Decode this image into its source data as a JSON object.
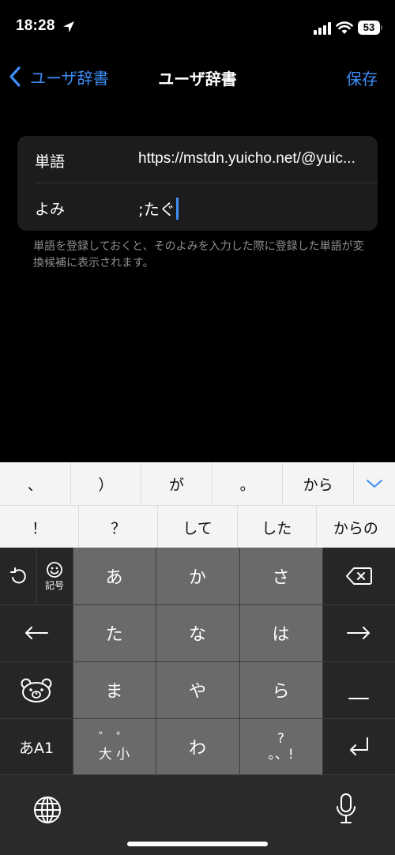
{
  "status_bar": {
    "time": "18:28",
    "battery": "53",
    "icons": [
      "location-arrow-icon",
      "cellular-signal-icon",
      "wifi-icon",
      "battery-icon"
    ]
  },
  "nav": {
    "back_label": "ユーザ辞書",
    "title": "ユーザ辞書",
    "save_label": "保存"
  },
  "form": {
    "word_label": "単語",
    "word_value": "https://mstdn.yuicho.net/@yuic...",
    "yomi_label": "よみ",
    "yomi_value": ";たぐ"
  },
  "help_text": "単語を登録しておくと、そのよみを入力した際に登録した単語が変換候補に表示されます。",
  "keyboard": {
    "candidates_row1": [
      "、",
      "）",
      "が",
      "。",
      "から"
    ],
    "candidates_row2": [
      "！",
      "？",
      "して",
      "した",
      "からの"
    ],
    "kana_keys": [
      "あ",
      "か",
      "さ",
      "た",
      "な",
      "は",
      "ま",
      "や",
      "ら",
      "わ"
    ],
    "symbol_key_label": "記号",
    "mode_key_label": "あA1",
    "dakuten_key": {
      "top": "゛ ゜",
      "bottom": "大 小"
    },
    "punct_key": {
      "top": "?",
      "bottom": "。、!"
    },
    "accent_color": "#3e8ef7",
    "icons": [
      "undo-icon",
      "emoji-icon",
      "delete-icon",
      "arrow-left-icon",
      "arrow-right-icon",
      "bear-emoticon-icon",
      "space-icon",
      "return-icon",
      "globe-icon",
      "microphone-icon",
      "chevron-down-icon"
    ]
  }
}
